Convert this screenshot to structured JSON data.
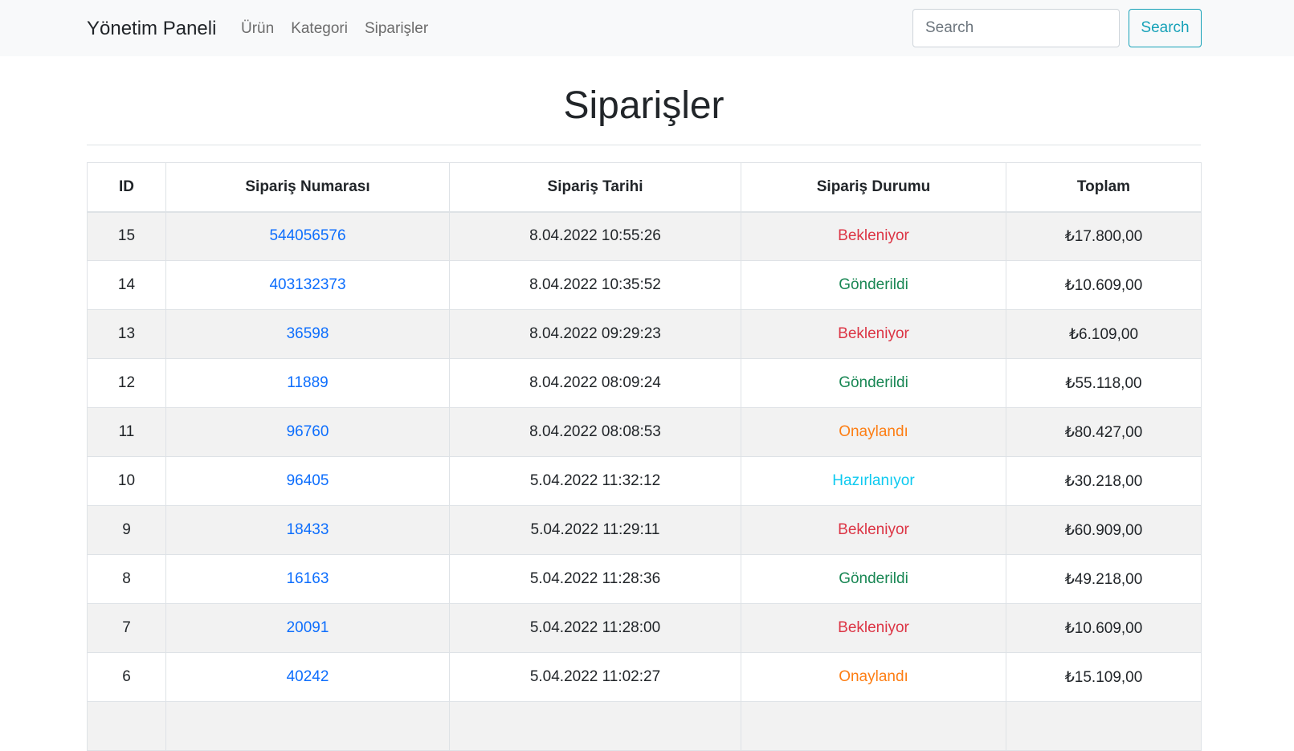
{
  "navbar": {
    "brand": "Yönetim Paneli",
    "links": [
      "Ürün",
      "Kategori",
      "Siparişler"
    ],
    "search_placeholder": "Search",
    "search_button": "Search"
  },
  "page": {
    "title": "Siparişler"
  },
  "table": {
    "headers": [
      "ID",
      "Sipariş Numarası",
      "Sipariş Tarihi",
      "Sipariş Durumu",
      "Toplam"
    ],
    "rows": [
      {
        "id": "15",
        "order_no": "544056576",
        "date": "8.04.2022 10:55:26",
        "status": "Bekleniyor",
        "status_class": "st-bekleniyor",
        "total": "₺17.800,00"
      },
      {
        "id": "14",
        "order_no": "403132373",
        "date": "8.04.2022 10:35:52",
        "status": "Gönderildi",
        "status_class": "st-gonderildi",
        "total": "₺10.609,00"
      },
      {
        "id": "13",
        "order_no": "36598",
        "date": "8.04.2022 09:29:23",
        "status": "Bekleniyor",
        "status_class": "st-bekleniyor",
        "total": "₺6.109,00"
      },
      {
        "id": "12",
        "order_no": "11889",
        "date": "8.04.2022 08:09:24",
        "status": "Gönderildi",
        "status_class": "st-gonderildi",
        "total": "₺55.118,00"
      },
      {
        "id": "11",
        "order_no": "96760",
        "date": "8.04.2022 08:08:53",
        "status": "Onaylandı",
        "status_class": "st-onaylandi",
        "total": "₺80.427,00"
      },
      {
        "id": "10",
        "order_no": "96405",
        "date": "5.04.2022 11:32:12",
        "status": "Hazırlanıyor",
        "status_class": "st-hazirlaniyor",
        "total": "₺30.218,00"
      },
      {
        "id": "9",
        "order_no": "18433",
        "date": "5.04.2022 11:29:11",
        "status": "Bekleniyor",
        "status_class": "st-bekleniyor",
        "total": "₺60.909,00"
      },
      {
        "id": "8",
        "order_no": "16163",
        "date": "5.04.2022 11:28:36",
        "status": "Gönderildi",
        "status_class": "st-gonderildi",
        "total": "₺49.218,00"
      },
      {
        "id": "7",
        "order_no": "20091",
        "date": "5.04.2022 11:28:00",
        "status": "Bekleniyor",
        "status_class": "st-bekleniyor",
        "total": "₺10.609,00"
      },
      {
        "id": "6",
        "order_no": "40242",
        "date": "5.04.2022 11:02:27",
        "status": "Onaylandı",
        "status_class": "st-onaylandi",
        "total": "₺15.109,00"
      },
      {
        "id": "",
        "order_no": "",
        "date": "",
        "status": "",
        "status_class": "",
        "total": ""
      }
    ]
  },
  "colors": {
    "status_bekleniyor": "#dc3545",
    "status_gonderildi": "#198754",
    "status_onaylandi": "#fd7e14",
    "status_hazirlaniyor": "#0dcaf0",
    "link": "#0d6efd",
    "search_button": "#17a2b8"
  }
}
